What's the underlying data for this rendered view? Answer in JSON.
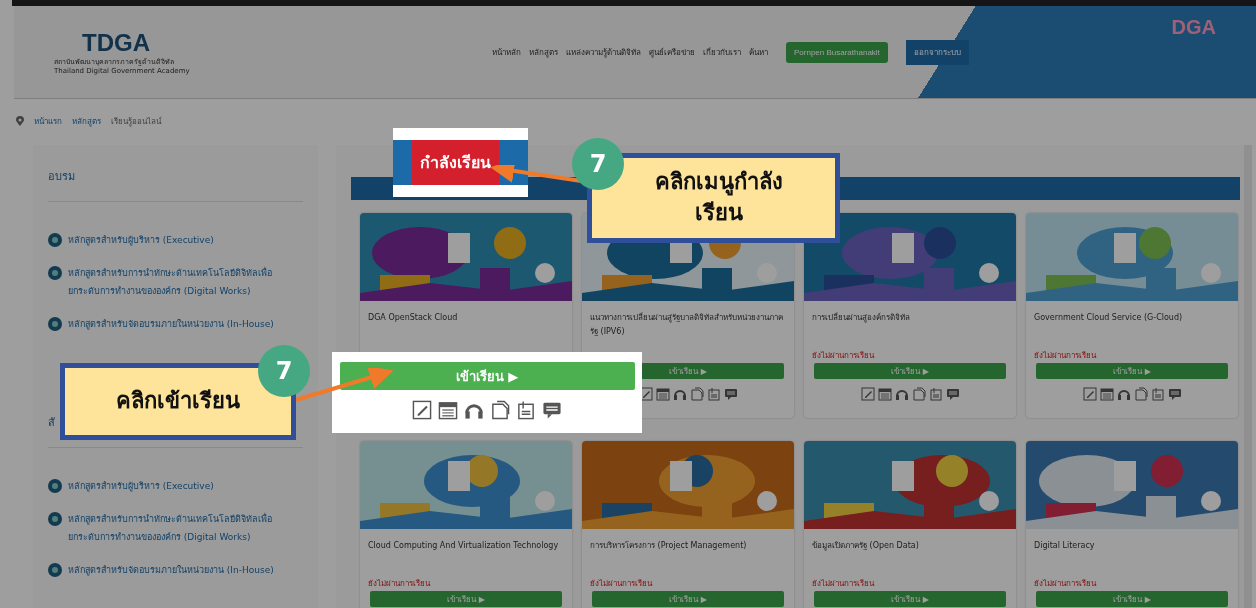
{
  "header": {
    "logo": "TDGA",
    "org_th": "สถาบันพัฒนาบุคลากรภาครัฐด้านดิจิทัล",
    "org_en": "Thailand Digital Government Academy",
    "nav": [
      "หน้าหลัก",
      "หลักสูตร",
      "แหล่งความรู้ด้านดิจิทัล",
      "ศูนย์เครือข่าย",
      "เกี่ยวกับเรา",
      "ค้นหา"
    ],
    "user_button": "Pornpen Busarathanakit",
    "logout_button": "ออกจากระบบ",
    "brand": "DGA"
  },
  "breadcrumb": [
    "หน้าแรก",
    "หลักสูตร",
    "เรียนรู้ออนไลน์"
  ],
  "sidebar": {
    "sections": [
      {
        "heading": "อบรม",
        "items": [
          "หลักสูตรสำหรับผู้บริหาร (Executive)",
          "หลักสูตรสำหรับการนำทักษะด้านเทคโนโลยีดิจิทัลเพื่อยกระดับการทำงานขององค์กร (Digital Works)",
          "หลักสูตรสำหรับจัดอบรมภายในหน่วยงาน (In-House)"
        ]
      },
      {
        "heading": "สั",
        "items": [
          "หลักสูตรสำหรับผู้บริหาร (Executive)",
          "หลักสูตรสำหรับการนำทักษะด้านเทคโนโลยีดิจิทัลเพื่อยกระดับการทำงานขององค์กร (Digital Works)",
          "หลักสูตรสำหรับจัดอบรมภายในหน่วยงาน (In-House)"
        ]
      }
    ]
  },
  "main": {
    "cards": [
      {
        "title": "DGA OpenStack Cloud"
      },
      {
        "title": "แนวทางการเปลี่ยนผ่านสู่รัฐบาลดิจิทัลสำหรับหน่วยงานภาครัฐ (IPV6)",
        "button": "เข้าเรียน ▶"
      },
      {
        "title": "การเปลี่ยนผ่านสู่องค์กรดิจิทัล",
        "status": "ยังไม่ผ่านการเรียน",
        "button": "เข้าเรียน ▶"
      },
      {
        "title": "Government Cloud Service (G-Cloud)",
        "status": "ยังไม่ผ่านการเรียน",
        "button": "เข้าเรียน ▶"
      },
      {
        "title": "Cloud Computing And Virtualization Technology",
        "status": "ยังไม่ผ่านการเรียน",
        "button": "เข้าเรียน ▶"
      },
      {
        "title": "การบริหารโครงการ (Project Management)",
        "status": "ยังไม่ผ่านการเรียน",
        "button": "เข้าเรียน ▶"
      },
      {
        "title": "ข้อมูลเปิดภาครัฐ (Open Data)",
        "status": "ยังไม่ผ่านการเรียน",
        "button": "เข้าเรียน ▶"
      },
      {
        "title": "Digital Literacy",
        "status": "ยังไม่ผ่านการเรียน",
        "button": "เข้าเรียน ▶"
      }
    ]
  },
  "annotations": [
    {
      "kind": "tab",
      "label": "กำลังเรียน"
    },
    {
      "kind": "callout",
      "step": "7",
      "text": "คลิกเมนูกำลังเรียน"
    },
    {
      "kind": "button",
      "label": "เข้าเรียน ▶"
    },
    {
      "kind": "callout",
      "step": "7",
      "text": "คลิกเข้าเรียน"
    }
  ]
}
